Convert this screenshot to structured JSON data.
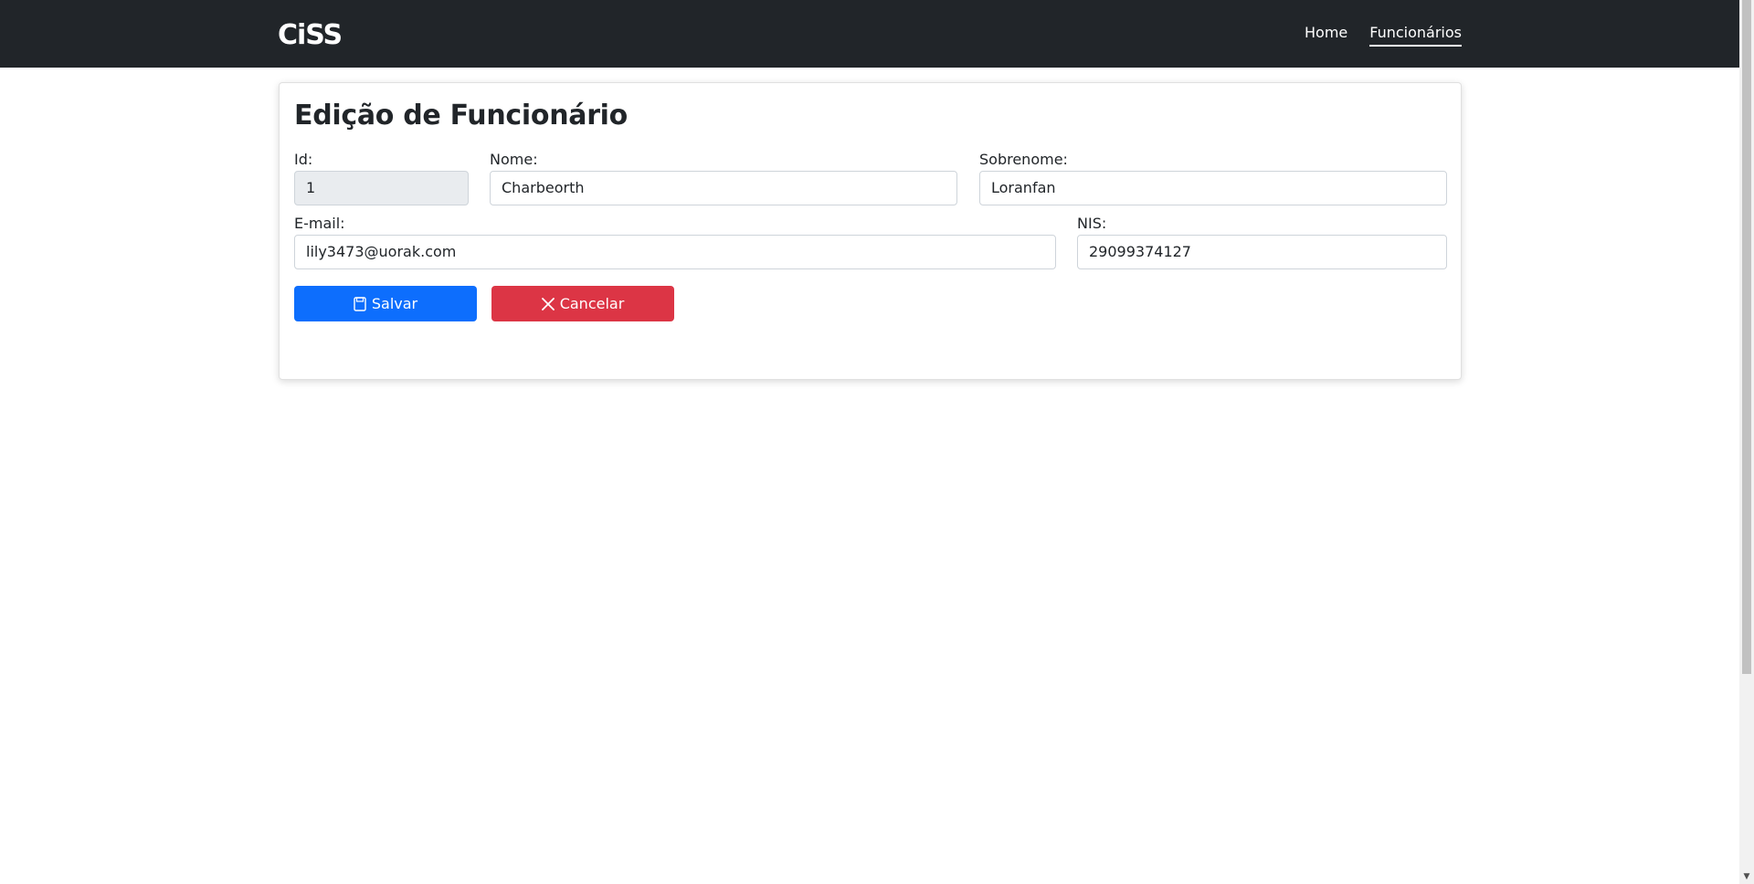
{
  "navbar": {
    "brand": "CiSS",
    "links": [
      {
        "label": "Home"
      },
      {
        "label": "Funcionários"
      }
    ]
  },
  "form": {
    "title": "Edição de Funcionário",
    "fields": {
      "id": {
        "label": "Id:",
        "value": "1"
      },
      "nome": {
        "label": "Nome:",
        "value": "Charbeorth"
      },
      "sobrenome": {
        "label": "Sobrenome:",
        "value": "Loranfan"
      },
      "email": {
        "label": "E-mail:",
        "value": "lily3473@uorak.com"
      },
      "nis": {
        "label": "NIS:",
        "value": "29099374127"
      }
    },
    "buttons": {
      "save": {
        "label": "Salvar",
        "icon": "floppy-disk-icon",
        "color": "#0d6efd"
      },
      "cancel": {
        "label": "Cancelar",
        "icon": "x-icon",
        "color": "#dc3545"
      }
    }
  }
}
